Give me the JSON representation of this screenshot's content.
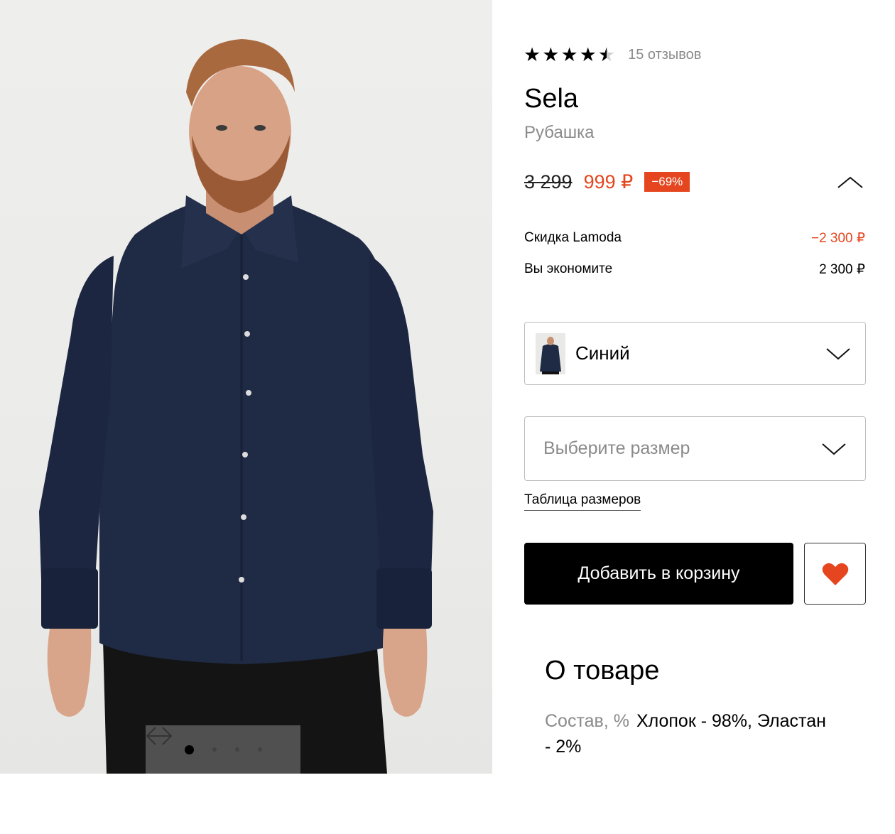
{
  "gallery": {
    "image_alt": "Модель в тёмно-синей рубашке",
    "prev_icon": "arrow-left-icon",
    "next_icon": "arrow-right-icon",
    "dots": [
      true,
      false,
      false,
      false
    ]
  },
  "rating": {
    "stars": 4.5,
    "reviews_label": "15 отзывов"
  },
  "product": {
    "brand": "Sela",
    "category": "Рубашка"
  },
  "price": {
    "old": "3 299",
    "new": "999 ₽",
    "discount_badge": "−69%",
    "toggle_icon": "chevron-up-icon"
  },
  "breakdown": {
    "discount_label": "Скидка Lamoda",
    "discount_value": "−2 300 ₽",
    "savings_label": "Вы экономите",
    "savings_value": "2 300 ₽"
  },
  "color_select": {
    "value": "Синий",
    "icon": "chevron-down-icon"
  },
  "size_select": {
    "placeholder": "Выберите размер",
    "icon": "chevron-down-icon"
  },
  "size_table_link": "Таблица размеров",
  "actions": {
    "add_to_cart": "Добавить в корзину",
    "favorite_icon": "heart-icon"
  },
  "about": {
    "title": "О товаре",
    "composition_label": "Состав, %",
    "composition_value": "Хлопок - 98%, Эластан - 2%"
  },
  "colors": {
    "accent": "#e5461f",
    "shirt": "#1f2a44",
    "button_bg": "#000000"
  }
}
